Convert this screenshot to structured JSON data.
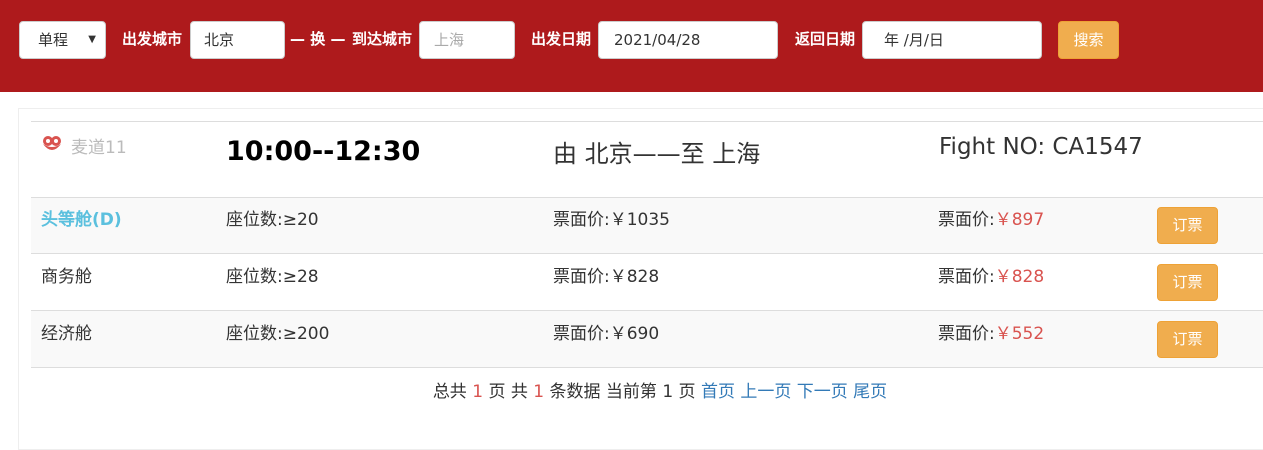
{
  "search": {
    "trip_type": "单程",
    "from_label": "出发城市",
    "from_value": "北京",
    "swap_label": "— 换 —",
    "to_label": "到达城市",
    "to_placeholder": "上海",
    "depart_label": "出发日期",
    "depart_value": "2021/04/28",
    "return_label": "返回日期",
    "return_placeholder": "年 /月/日",
    "search_button": "搜索"
  },
  "flight": {
    "airline": "麦道11",
    "time": "10:00--12:30",
    "route": "由 北京——至 上海",
    "flight_no": "Fight NO: CA1547"
  },
  "cabins": [
    {
      "name": "头等舱(D)",
      "seats": "座位数:≥20",
      "face_price": "票面价:￥1035",
      "sale_label": "票面价:",
      "sale_price": "￥897",
      "button": "订票"
    },
    {
      "name": "商务舱",
      "seats": "座位数:≥28",
      "face_price": "票面价:￥828",
      "sale_label": "票面价:",
      "sale_price": "￥828",
      "button": "订票"
    },
    {
      "name": "经济舱",
      "seats": "座位数:≥200",
      "face_price": "票面价:￥690",
      "sale_label": "票面价:",
      "sale_price": "￥552",
      "button": "订票"
    }
  ],
  "pager": {
    "t1": "总共 ",
    "total_pages": "1",
    "t2": " 页 共 ",
    "total_records": "1",
    "t3": " 条数据 当前第 ",
    "current_page": "1",
    "t4": " 页 ",
    "first": "首页",
    "prev": "上一页",
    "next": "下一页",
    "last": "尾页"
  },
  "colors": {
    "header_bg": "#ae1a1c",
    "button": "#f0ad4e",
    "highlight": "#5bc0de",
    "price_red": "#d9534f",
    "link": "#337ab7"
  }
}
